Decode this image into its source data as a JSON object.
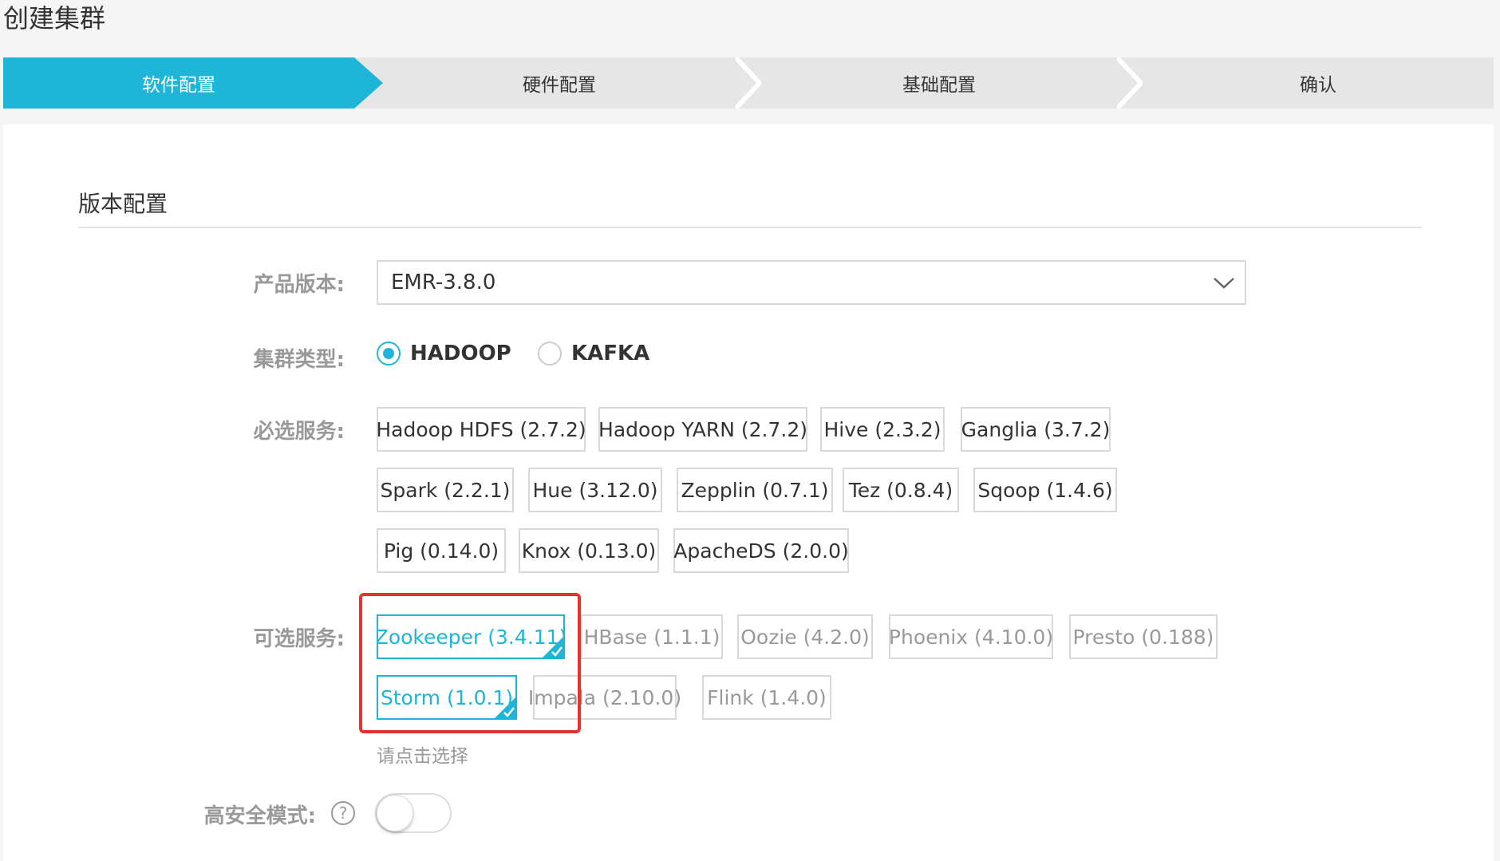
{
  "page": {
    "title": "创建集群"
  },
  "steps": [
    {
      "label": "软件配置",
      "active": true
    },
    {
      "label": "硬件配置",
      "active": false
    },
    {
      "label": "基础配置",
      "active": false
    },
    {
      "label": "确认",
      "active": false
    }
  ],
  "section": {
    "title": "版本配置"
  },
  "product_version": {
    "label": "产品版本:",
    "value": "EMR-3.8.0"
  },
  "cluster_type": {
    "label": "集群类型:",
    "options": [
      {
        "label": "HADOOP",
        "checked": true
      },
      {
        "label": "KAFKA",
        "checked": false
      }
    ]
  },
  "required_services": {
    "label": "必选服务:",
    "items": [
      "Hadoop HDFS (2.7.2)",
      "Hadoop YARN (2.7.2)",
      "Hive (2.3.2)",
      "Ganglia (3.7.2)",
      "Spark (2.2.1)",
      "Hue (3.12.0)",
      "Zepplin (0.7.1)",
      "Tez (0.8.4)",
      "Sqoop (1.4.6)",
      "Pig (0.14.0)",
      "Knox (0.13.0)",
      "ApacheDS (2.0.0)"
    ]
  },
  "optional_services": {
    "label": "可选服务:",
    "items": [
      {
        "label": "Zookeeper (3.4.11)",
        "selected": true
      },
      {
        "label": "HBase (1.1.1)",
        "selected": false
      },
      {
        "label": "Oozie (4.2.0)",
        "selected": false
      },
      {
        "label": "Phoenix (4.10.0)",
        "selected": false
      },
      {
        "label": "Presto (0.188)",
        "selected": false
      },
      {
        "label": "Storm (1.0.1)",
        "selected": true
      },
      {
        "label": "Impala (2.10.0)",
        "selected": false
      },
      {
        "label": "Flink (1.4.0)",
        "selected": false
      }
    ],
    "hint": "请点击选择"
  },
  "high_security": {
    "label": "高安全模式:",
    "enabled": false
  },
  "colors": {
    "accent": "#1fb5d8",
    "highlight": "#e8322f"
  },
  "icons": {
    "select_caret": "chevron-down-icon",
    "help": "question-circle-icon",
    "tag_check": "checkmark-icon"
  }
}
